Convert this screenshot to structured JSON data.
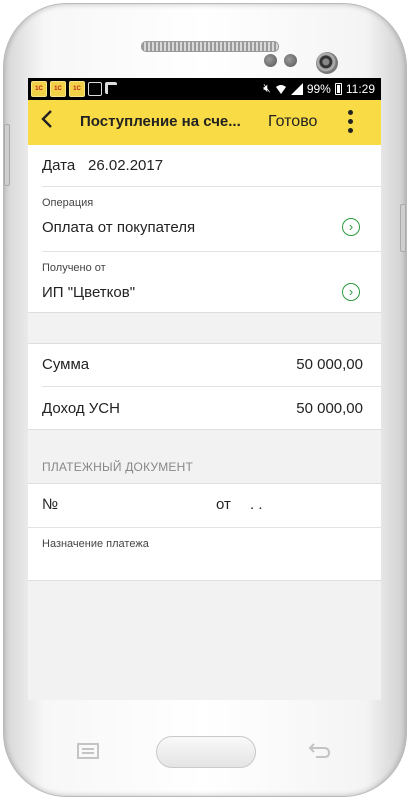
{
  "statusbar": {
    "icon1": "1C",
    "icon2": "1C",
    "icon3": "1C",
    "battery": "99%",
    "time": "11:29"
  },
  "toolbar": {
    "title": "Поступление на сче...",
    "done_label": "Готово",
    "back_icon": "‹"
  },
  "form": {
    "date_label": "Дата",
    "date_value": "26.02.2017",
    "operation_label": "Операция",
    "operation_value": "Оплата от покупателя",
    "received_label": "Получено от",
    "received_value": "ИП \"Цветков\"",
    "sum_label": "Сумма",
    "sum_value": "50 000,00",
    "income_label": "Доход УСН",
    "income_value": "50 000,00",
    "payment_header": "ПЛАТЕЖНЫЙ ДОКУМЕНТ",
    "number_label": "№",
    "from_label": "от",
    "from_value": ". .",
    "purpose_label": "Назначение платежа"
  },
  "colors": {
    "toolbar": "#f9dc45",
    "accent_green": "#2d9b3e"
  }
}
